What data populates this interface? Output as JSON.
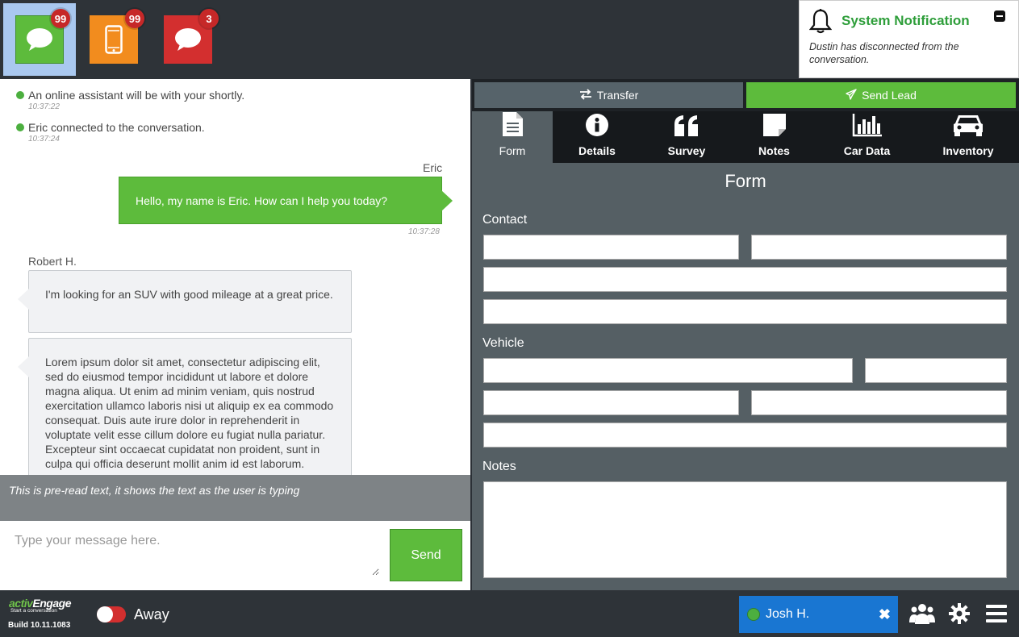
{
  "channels": [
    {
      "type": "chat",
      "count": "99",
      "color": "#5dbb3c",
      "active": true
    },
    {
      "type": "mobile",
      "count": "99",
      "color": "#f28c1e",
      "active": false
    },
    {
      "type": "chat",
      "count": "3",
      "color": "#d32f2f",
      "active": false
    }
  ],
  "notification": {
    "title": "System Notification",
    "message": "Dustin has disconnected from the conversation."
  },
  "chat": {
    "system_messages": [
      {
        "text": "An online assistant will be with your shortly.",
        "time": "10:37:22"
      },
      {
        "text": "Eric connected to the conversation.",
        "time": "10:37:24"
      }
    ],
    "agent_name": "Eric",
    "agent_message": "Hello, my name is Eric. How can I help you today?",
    "agent_message_time": "10:37:28",
    "visitor_name": "Robert H.",
    "visitor_messages": [
      "I'm looking for an SUV with good mileage at a great price.",
      "Lorem ipsum dolor sit amet, consectetur adipiscing elit, sed do eiusmod tempor incididunt ut labore et dolore magna aliqua. Ut enim ad minim veniam, quis nostrud exercitation ullamco laboris nisi ut aliquip ex ea commodo consequat. Duis aute irure dolor in reprehenderit in voluptate velit esse cillum dolore eu fugiat nulla pariatur. Excepteur sint occaecat cupidatat non proident, sunt in culpa qui officia deserunt mollit anim id est laborum."
    ],
    "preread": "This is pre-read text, it shows the text as the user is typing",
    "input_placeholder": "Type your message here.",
    "send_label": "Send"
  },
  "actions": {
    "transfer_label": "Transfer",
    "send_lead_label": "Send Lead"
  },
  "tabs": [
    {
      "label": "Form",
      "icon": "document-icon",
      "active": true
    },
    {
      "label": "Details",
      "icon": "info-icon",
      "active": false
    },
    {
      "label": "Survey",
      "icon": "quote-icon",
      "active": false
    },
    {
      "label": "Notes",
      "icon": "sticky-note-icon",
      "active": false
    },
    {
      "label": "Car Data",
      "icon": "bar-chart-icon",
      "active": false
    },
    {
      "label": "Inventory",
      "icon": "car-icon",
      "active": false
    }
  ],
  "form": {
    "title": "Form",
    "contact_label": "Contact",
    "vehicle_label": "Vehicle",
    "notes_label": "Notes"
  },
  "footer": {
    "brand_prefix": "activ",
    "brand_suffix": "Engage",
    "tagline": "Start a conversation",
    "build": "Build 10.11.1083",
    "status": "Away",
    "agent_name": "Josh H."
  },
  "colors": {
    "accent_green": "#5dbb3c",
    "agent_blue": "#1976d2",
    "badge_red": "#c62828"
  }
}
